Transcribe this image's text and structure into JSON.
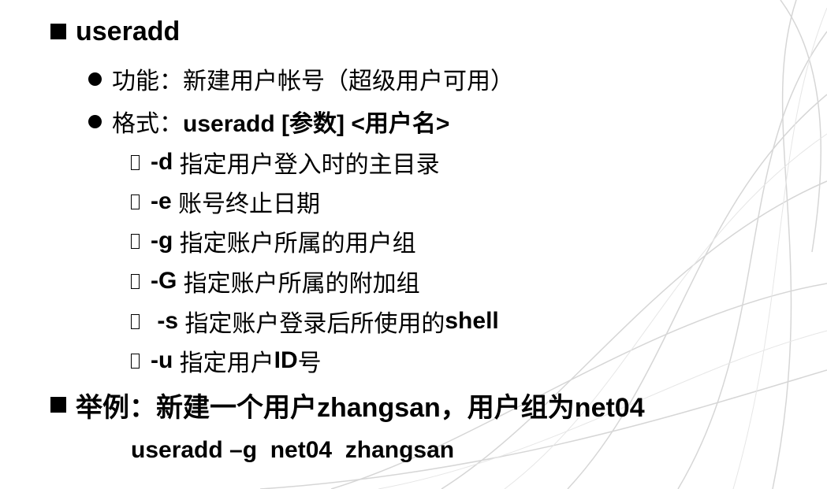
{
  "heading1": "useradd",
  "bullets": [
    {
      "label": "功能：",
      "value": "新建用户帐号（超级用户可用）"
    },
    {
      "label": "格式：",
      "value": "useradd [参数] <用户名>"
    }
  ],
  "options": [
    {
      "flag": "-d",
      "desc": "指定用户登入时的主目录"
    },
    {
      "flag": "-e",
      "desc": "账号终止日期"
    },
    {
      "flag": "-g",
      "desc": "指定账户所属的用户组"
    },
    {
      "flag": "-G",
      "desc": "指定账户所属的附加组"
    },
    {
      "flag": "-s",
      "desc": "指定账户登录后所使用的",
      "desc_bold": "shell"
    },
    {
      "flag": "-u",
      "desc": "指定用户",
      "desc_bold": "ID",
      "desc_tail": "号"
    }
  ],
  "heading2": "举例：新建一个用户zhangsan，用户组为net04",
  "example_command": "useradd –g  net04  zhangsan"
}
